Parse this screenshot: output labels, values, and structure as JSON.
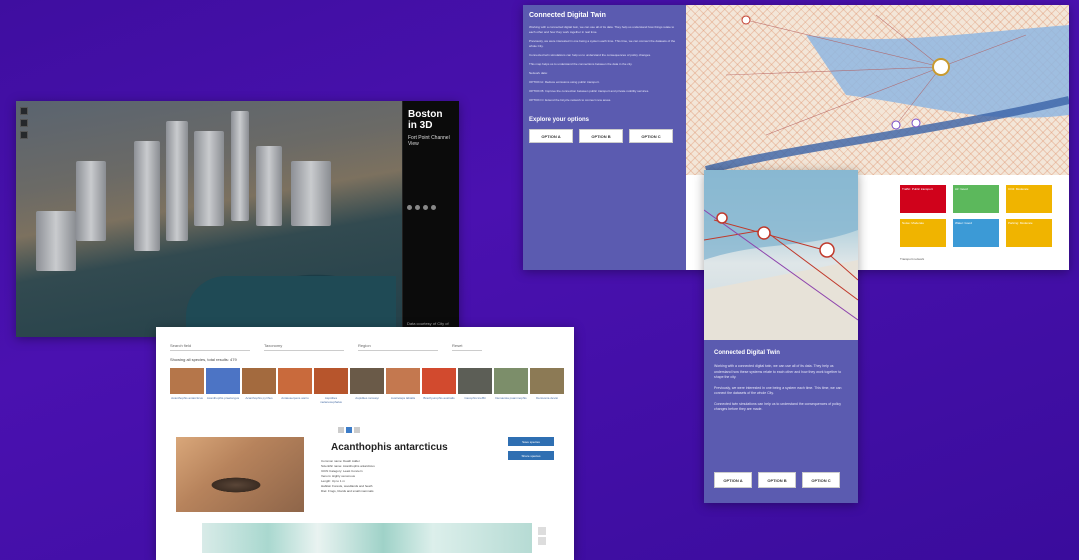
{
  "boston": {
    "title": "Boston in 3D",
    "sidebar_text": "Fort Point Channel View",
    "footer": "Data courtesy of City of Boston open data"
  },
  "twin": {
    "title": "Connected Digital Twin",
    "paras": [
      "Working with a connected digital twin, we can use all of its data. They help us understand how things relate to each other and how they work together in real time.",
      "Previously, we were interested in one being a system each time. This time, we can connect the datasets of the whole City.",
      "Connected twin simulations can help us to understand the consequences of policy changes.",
      "This map helps us to understand the connections between the data in the city.",
      "Network data:",
      "OPTION A: Reduce emissions using public transport.",
      "OPTION B: Improve the connection between public transport and private mobility services.",
      "OPTION C: Extend the bicycle network to connect new areas."
    ],
    "explore_heading": "Explore your options",
    "buttons": [
      "OPTION A",
      "OPTION B",
      "OPTION C"
    ],
    "tiles": [
      {
        "label": "Traffic: Public transport",
        "color": "#d0021b"
      },
      {
        "label": "Air: Good",
        "color": "#5cb85c"
      },
      {
        "label": "CO2: Moderate",
        "color": "#f0b400"
      },
      {
        "label": "Noise: Moderate",
        "color": "#f0b400"
      },
      {
        "label": "Water: Good",
        "color": "#3c9ad6"
      },
      {
        "label": "Parking: Moderate",
        "color": "#f0b400"
      }
    ],
    "footer_note": "Transport network"
  },
  "snake": {
    "filters": [
      "Search field",
      "Taxonomy",
      "Region",
      "Reset"
    ],
    "results": "Showing all species, total results: 479",
    "thumbs": [
      {
        "cap": "Acanthophis antarcticus",
        "c": "#b5764a"
      },
      {
        "cap": "Acanthophis praelongus",
        "c": "#4c74c5"
      },
      {
        "cap": "Acanthophis pyrrhus",
        "c": "#a36a3e"
      },
      {
        "cap": "Antaioserpens warro",
        "c": "#c96a3c"
      },
      {
        "cap": "Aspidites melanocephalus",
        "c": "#b7552c"
      },
      {
        "cap": "Aspidites ramsayi",
        "c": "#6a5a48"
      },
      {
        "cap": "Austrelaps labialis",
        "c": "#c4784f"
      },
      {
        "cap": "Brachyurophis australis",
        "c": "#d24a2e"
      },
      {
        "cap": "Cacophis krefftii",
        "c": "#5c5e56"
      },
      {
        "cap": "Demansia psammophis",
        "c": "#7c8e6a"
      },
      {
        "cap": "Denisonia devisi",
        "c": "#8c7a55"
      }
    ],
    "species": "Acanthophis antarcticus",
    "facts": [
      "Common name: Death Adder",
      "Scientific name: Acanthophis antarcticus",
      "IUCN Category: Least Concern",
      "Venom: Highly venomous",
      "Length: Up to 1 m",
      "Habitat: Forests, woodlands and heath",
      "Diet: Frogs, lizards and small mammals"
    ],
    "side_buttons": [
      "Save species",
      "Share species"
    ]
  },
  "twin2": {
    "title": "Connected Digital Twin",
    "paras": [
      "Working with a connected digital twin, we can use all of its data. They help us understand how these systems relate to each other and how they work together to shape the city.",
      "Previously, we were interested in one being a system each time. This time, we can connect the datasets of the whole City.",
      "Connected twin simulations can help us to understand the consequences of policy changes before they are made."
    ],
    "buttons": [
      "OPTION A",
      "OPTION B",
      "OPTION C"
    ]
  }
}
